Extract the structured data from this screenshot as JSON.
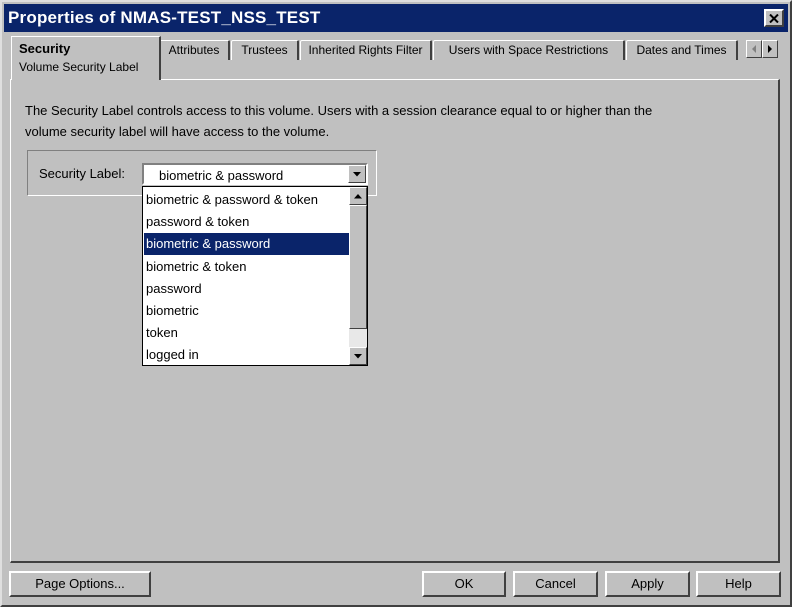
{
  "window": {
    "title": "Properties of NMAS-TEST_NSS_TEST"
  },
  "tabs": {
    "active": {
      "label": "Security",
      "sublabel": "Volume Security Label"
    },
    "items": [
      {
        "label": "Attributes"
      },
      {
        "label": "Trustees"
      },
      {
        "label": "Inherited Rights Filter"
      },
      {
        "label": "Users with Space Restrictions"
      },
      {
        "label": "Dates and Times"
      }
    ]
  },
  "content": {
    "description_line1": "The Security Label controls access to this volume. Users with a session clearance equal to or higher than the",
    "description_line2": "volume security label will have access to the volume.",
    "security_label": {
      "label": "Security Label:",
      "selected": "biometric & password",
      "options": [
        "biometric & password & token",
        "password & token",
        "biometric & password",
        "biometric & token",
        "password",
        "biometric",
        "token",
        "logged in"
      ],
      "highlighted_index": 2
    }
  },
  "buttons": {
    "page_options": "Page Options...",
    "ok": "OK",
    "cancel": "Cancel",
    "apply": "Apply",
    "help": "Help"
  },
  "colors": {
    "titlebar": "#0a246a",
    "selection": "#0a246a",
    "face": "#c0c0c0"
  },
  "icons": {
    "close": "close-icon",
    "dropdown": "chevron-down-icon",
    "scroll_up": "arrow-up-icon",
    "scroll_down": "arrow-down-icon",
    "tab_left": "arrow-left-icon",
    "tab_right": "arrow-right-icon"
  }
}
